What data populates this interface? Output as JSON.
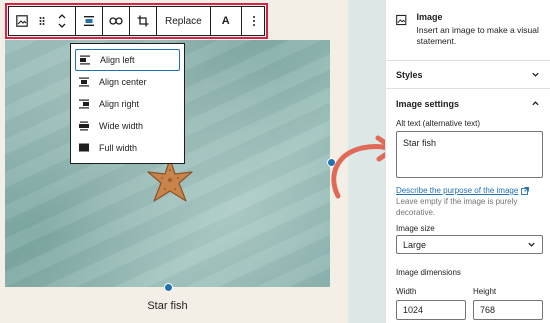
{
  "toolbar": {
    "replace_label": "Replace",
    "text_label": "A",
    "highlight_color": "#d6234b"
  },
  "align_menu": {
    "items": [
      {
        "label": "Align left",
        "icon": "align-left-icon",
        "active": true
      },
      {
        "label": "Align center",
        "icon": "align-center-icon",
        "active": false
      },
      {
        "label": "Align right",
        "icon": "align-right-icon",
        "active": false
      },
      {
        "label": "Wide width",
        "icon": "wide-width-icon",
        "active": false
      },
      {
        "label": "Full width",
        "icon": "full-width-icon",
        "active": false
      }
    ]
  },
  "image": {
    "caption": "Star fish"
  },
  "sidebar": {
    "block_title": "Image",
    "block_description": "Insert an image to make a visual statement.",
    "styles_label": "Styles",
    "settings_label": "Image settings",
    "alt_label": "Alt text (alternative text)",
    "alt_value": "Star fish",
    "alt_help_link": "Describe the purpose of the image",
    "alt_help_rest": " Leave empty if the image is purely decorative.",
    "size_label": "Image size",
    "size_value": "Large",
    "dimensions_label": "Image dimensions",
    "width_label": "Width",
    "height_label": "Height",
    "width_value": "1024",
    "height_value": "768"
  },
  "colors": {
    "accent": "#2271b1",
    "arrow": "#e06a57"
  }
}
